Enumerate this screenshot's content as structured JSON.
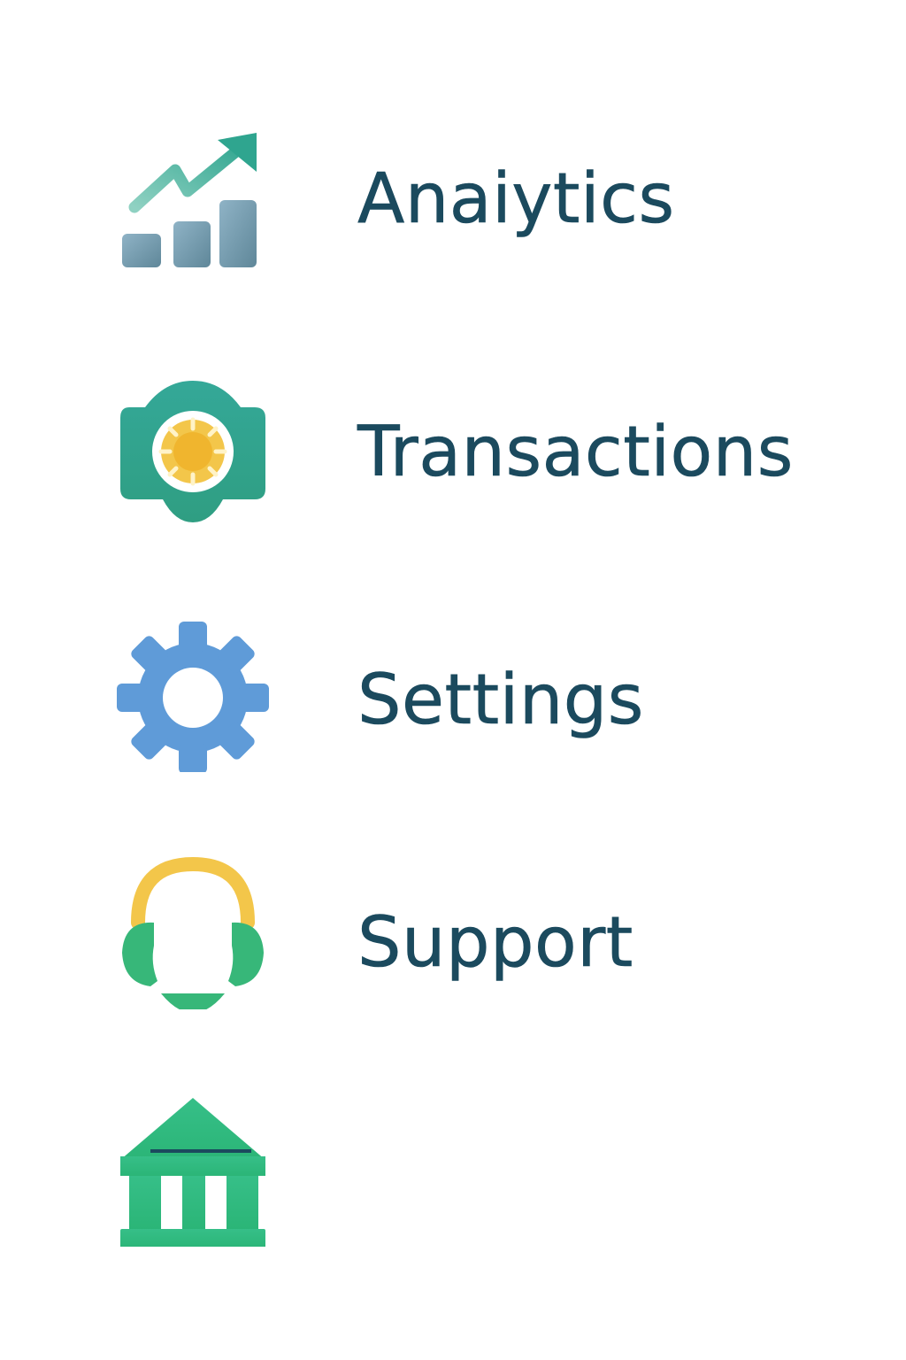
{
  "menu": {
    "items": [
      {
        "id": "analytics",
        "label": "Anaiytics",
        "icon": "analytics-chart-icon"
      },
      {
        "id": "transactions",
        "label": "Transactions",
        "icon": "safe-vault-icon"
      },
      {
        "id": "settings",
        "label": "Settings",
        "icon": "gear-icon"
      },
      {
        "id": "support",
        "label": "Support",
        "icon": "headset-icon"
      },
      {
        "id": "bank",
        "label": "",
        "icon": "bank-icon"
      }
    ]
  },
  "colors": {
    "label_text": "#1b4a5e",
    "teal": "#2fa58f",
    "slate_blue": "#6f96ad",
    "gold": "#f3b931",
    "gear_blue": "#5f9bd8",
    "green": "#33b77c"
  }
}
